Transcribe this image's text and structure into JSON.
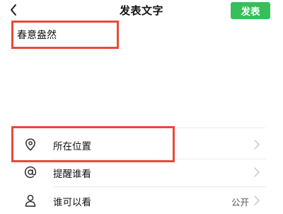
{
  "header": {
    "title": "发表文字",
    "publish_label": "发表"
  },
  "compose": {
    "text": "春意盎然"
  },
  "options": [
    {
      "label": "所在位置",
      "icon": "location-pin-icon",
      "value": ""
    },
    {
      "label": "提醒谁看",
      "icon": "at-icon",
      "value": ""
    },
    {
      "label": "谁可以看",
      "icon": "person-icon",
      "value": "公开"
    }
  ],
  "colors": {
    "publish_green": "#35c05a",
    "highlight_red": "#e64a3c"
  }
}
